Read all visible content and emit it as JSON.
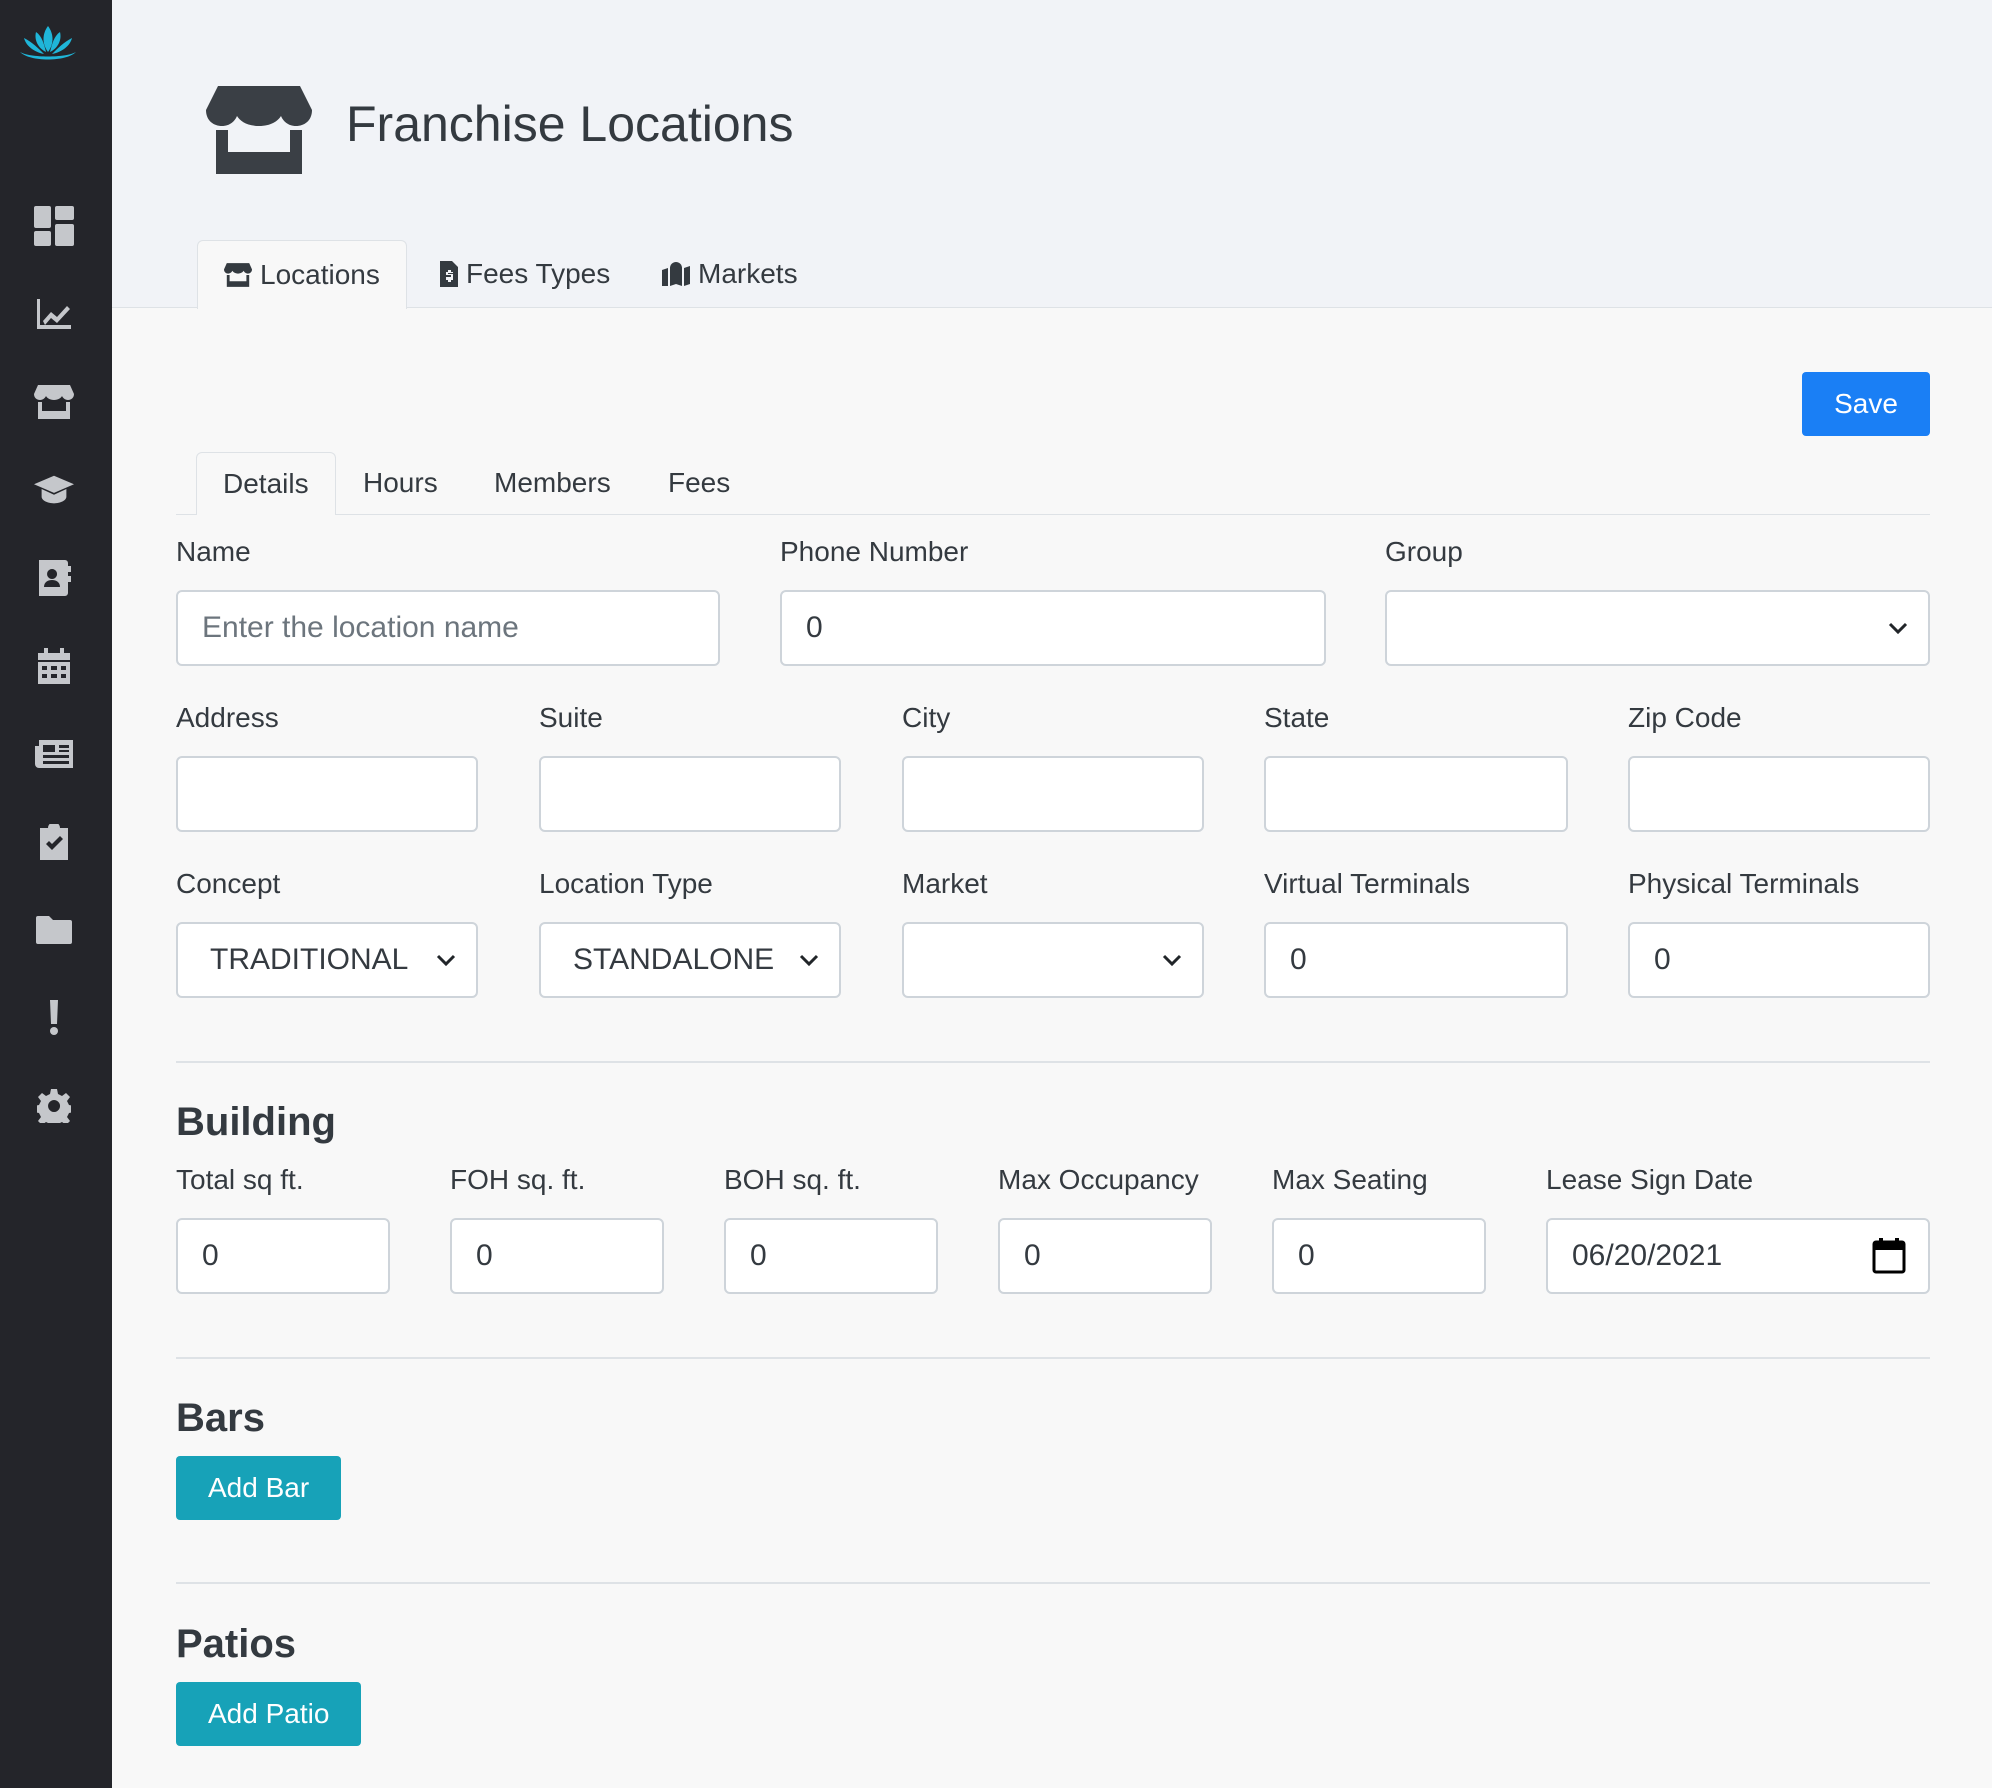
{
  "app": {
    "title": "Franchise Locations",
    "brand_color": "#1fb6d9",
    "sidebar_icons": [
      "lotus-logo-icon",
      "dashboard-icon",
      "chart-icon",
      "store-icon",
      "graduation-cap-icon",
      "contact-card-icon",
      "calendar-icon",
      "newspaper-icon",
      "clipboard-check-icon",
      "folder-icon",
      "exclamation-icon",
      "gear-icon"
    ]
  },
  "top_tabs": [
    {
      "label": "Locations",
      "icon": "store-icon",
      "active": true
    },
    {
      "label": "Fees Types",
      "icon": "invoice-icon",
      "active": false
    },
    {
      "label": "Markets",
      "icon": "map-marker-icon",
      "active": false
    }
  ],
  "toolbar": {
    "save_label": "Save",
    "save_color": "#1a7ff5"
  },
  "sub_tabs": [
    {
      "label": "Details",
      "active": true
    },
    {
      "label": "Hours",
      "active": false
    },
    {
      "label": "Members",
      "active": false
    },
    {
      "label": "Fees",
      "active": false
    }
  ],
  "form": {
    "name": {
      "label": "Name",
      "value": "",
      "placeholder": "Enter the location name"
    },
    "phone": {
      "label": "Phone Number",
      "value": "0"
    },
    "group": {
      "label": "Group",
      "value": ""
    },
    "address": {
      "label": "Address",
      "value": ""
    },
    "suite": {
      "label": "Suite",
      "value": ""
    },
    "city": {
      "label": "City",
      "value": ""
    },
    "state": {
      "label": "State",
      "value": ""
    },
    "zip": {
      "label": "Zip Code",
      "value": ""
    },
    "concept": {
      "label": "Concept",
      "value": "TRADITIONAL"
    },
    "location_type": {
      "label": "Location Type",
      "value": "STANDALONE"
    },
    "market": {
      "label": "Market",
      "value": ""
    },
    "virtual_terminals": {
      "label": "Virtual Terminals",
      "value": "0"
    },
    "physical_terminals": {
      "label": "Physical Terminals",
      "value": "0"
    }
  },
  "building": {
    "title": "Building",
    "total_sqft": {
      "label": "Total sq ft.",
      "value": "0"
    },
    "foh_sqft": {
      "label": "FOH sq. ft.",
      "value": "0"
    },
    "boh_sqft": {
      "label": "BOH sq. ft.",
      "value": "0"
    },
    "max_occupancy": {
      "label": "Max Occupancy",
      "value": "0"
    },
    "max_seating": {
      "label": "Max Seating",
      "value": "0"
    },
    "lease_sign_date": {
      "label": "Lease Sign Date",
      "value": "06/20/2021"
    }
  },
  "bars": {
    "title": "Bars",
    "add_label": "Add Bar"
  },
  "patios": {
    "title": "Patios",
    "add_label": "Add Patio"
  },
  "accent_color": "#17a2b8"
}
